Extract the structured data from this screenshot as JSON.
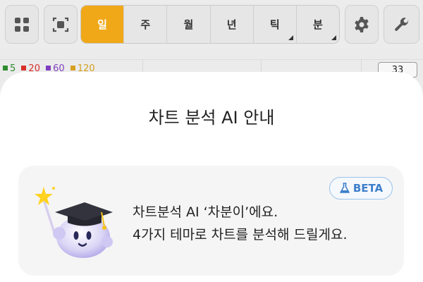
{
  "toolbar": {
    "periods": [
      {
        "label": "일",
        "active": true,
        "has_submenu": false
      },
      {
        "label": "주",
        "active": false,
        "has_submenu": false
      },
      {
        "label": "월",
        "active": false,
        "has_submenu": false
      },
      {
        "label": "년",
        "active": false,
        "has_submenu": false
      },
      {
        "label": "틱",
        "active": false,
        "has_submenu": true
      },
      {
        "label": "분",
        "active": false,
        "has_submenu": true
      }
    ],
    "icons": [
      "grid-icon",
      "capture-icon",
      "gear-icon",
      "wrench-icon"
    ],
    "accent_color": "#f0a818"
  },
  "chart": {
    "ma_legend": [
      {
        "label": "5",
        "color": "#2e8b2e"
      },
      {
        "label": "20",
        "color": "#d9302a"
      },
      {
        "label": "60",
        "color": "#7e3fbf"
      },
      {
        "label": "120",
        "color": "#d6a020"
      }
    ],
    "price_label": "33"
  },
  "sheet": {
    "title": "차트 분석 AI 안내",
    "badge": "BETA",
    "message_line1": "차트분석 AI ‘차분이’에요.",
    "message_line2": "4가지 테마로 차트를 분석해 드릴게요."
  }
}
